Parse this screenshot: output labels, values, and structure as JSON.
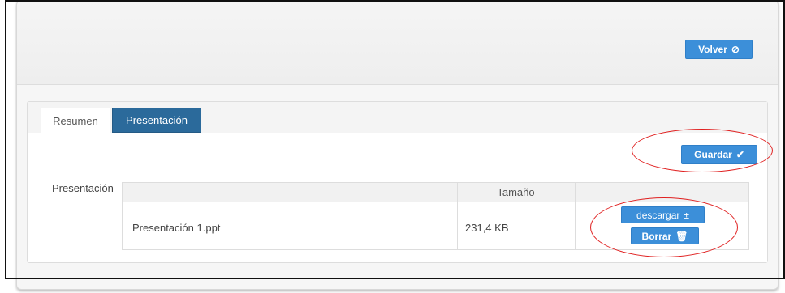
{
  "header": {
    "back_button_label": "Volver",
    "back_button_icon": "⊘"
  },
  "tabs": [
    {
      "label": "Resumen",
      "active": false
    },
    {
      "label": "Presentación",
      "active": true
    }
  ],
  "toolbar": {
    "save_label": "Guardar",
    "save_icon": "✔"
  },
  "presentation_section": {
    "label": "Presentación",
    "table": {
      "columns": [
        "",
        "Tamaño",
        ""
      ],
      "rows": [
        {
          "file_name": "Presentación 1.ppt",
          "size": "231,4 KB",
          "download_label": "descargar",
          "download_icon": "±",
          "delete_label": "Borrar",
          "delete_icon": "🗑"
        }
      ]
    }
  },
  "colors": {
    "accent": "#3c8fd9",
    "active_tab": "#2b6a9b",
    "annotation": "#e02020"
  }
}
